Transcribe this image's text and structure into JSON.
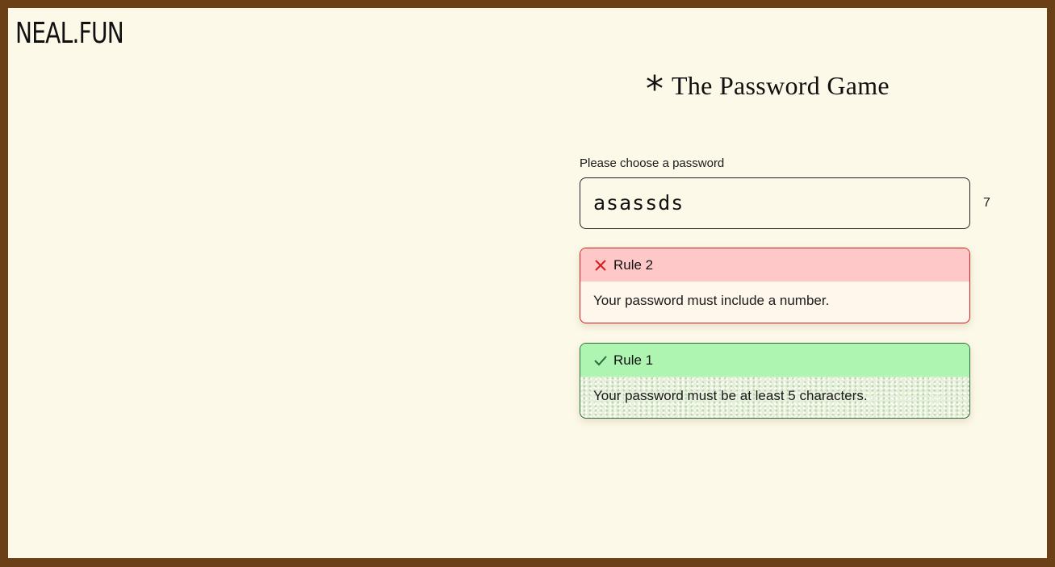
{
  "site": {
    "logo": "NEAL.FUN"
  },
  "game": {
    "title": "The Password Game",
    "title_icon": "asterisk-icon"
  },
  "password": {
    "label": "Please choose a password",
    "value": "asassds",
    "length": "7"
  },
  "rules": [
    {
      "status": "fail",
      "status_icon": "x-icon",
      "title": "Rule 2",
      "text": "Your password must include a number.",
      "color": "#d61f1f"
    },
    {
      "status": "pass",
      "status_icon": "check-icon",
      "title": "Rule 1",
      "text": "Your password must be at least 5 characters.",
      "color": "#2e6b3b"
    }
  ]
}
